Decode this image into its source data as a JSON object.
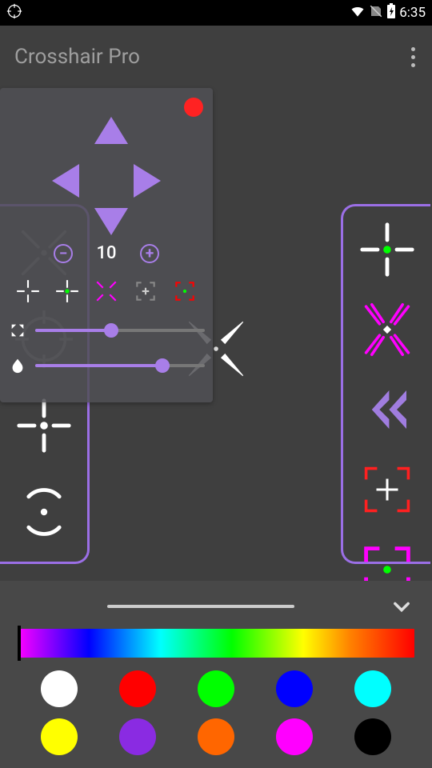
{
  "status": {
    "time": "6:35"
  },
  "header": {
    "title": "Crosshair Pro"
  },
  "panel": {
    "step_value": "10",
    "slider_size_pct": 45,
    "slider_opacity_pct": 75
  },
  "mini_presets": [
    "cross-white",
    "cross-green-dot",
    "x-magenta",
    "brackets-gray",
    "brackets-green"
  ],
  "left_rail_presets": [
    "x-gray",
    "circle-scope",
    "plus-dot",
    "broken-circle"
  ],
  "right_rail_presets": [
    "plus-green-dot",
    "x-magenta-slash",
    "chevron-left",
    "brackets-red-plus",
    "brackets-magenta-green"
  ],
  "center_preset": "x-blades",
  "spectrum_cursor_pct": 0,
  "swatches": [
    "#ffffff",
    "#ff0000",
    "#00ff00",
    "#0000ff",
    "#00ffff",
    "#ffff00",
    "#8a2be2",
    "#ff6600",
    "#ff00ff",
    "#000000"
  ]
}
